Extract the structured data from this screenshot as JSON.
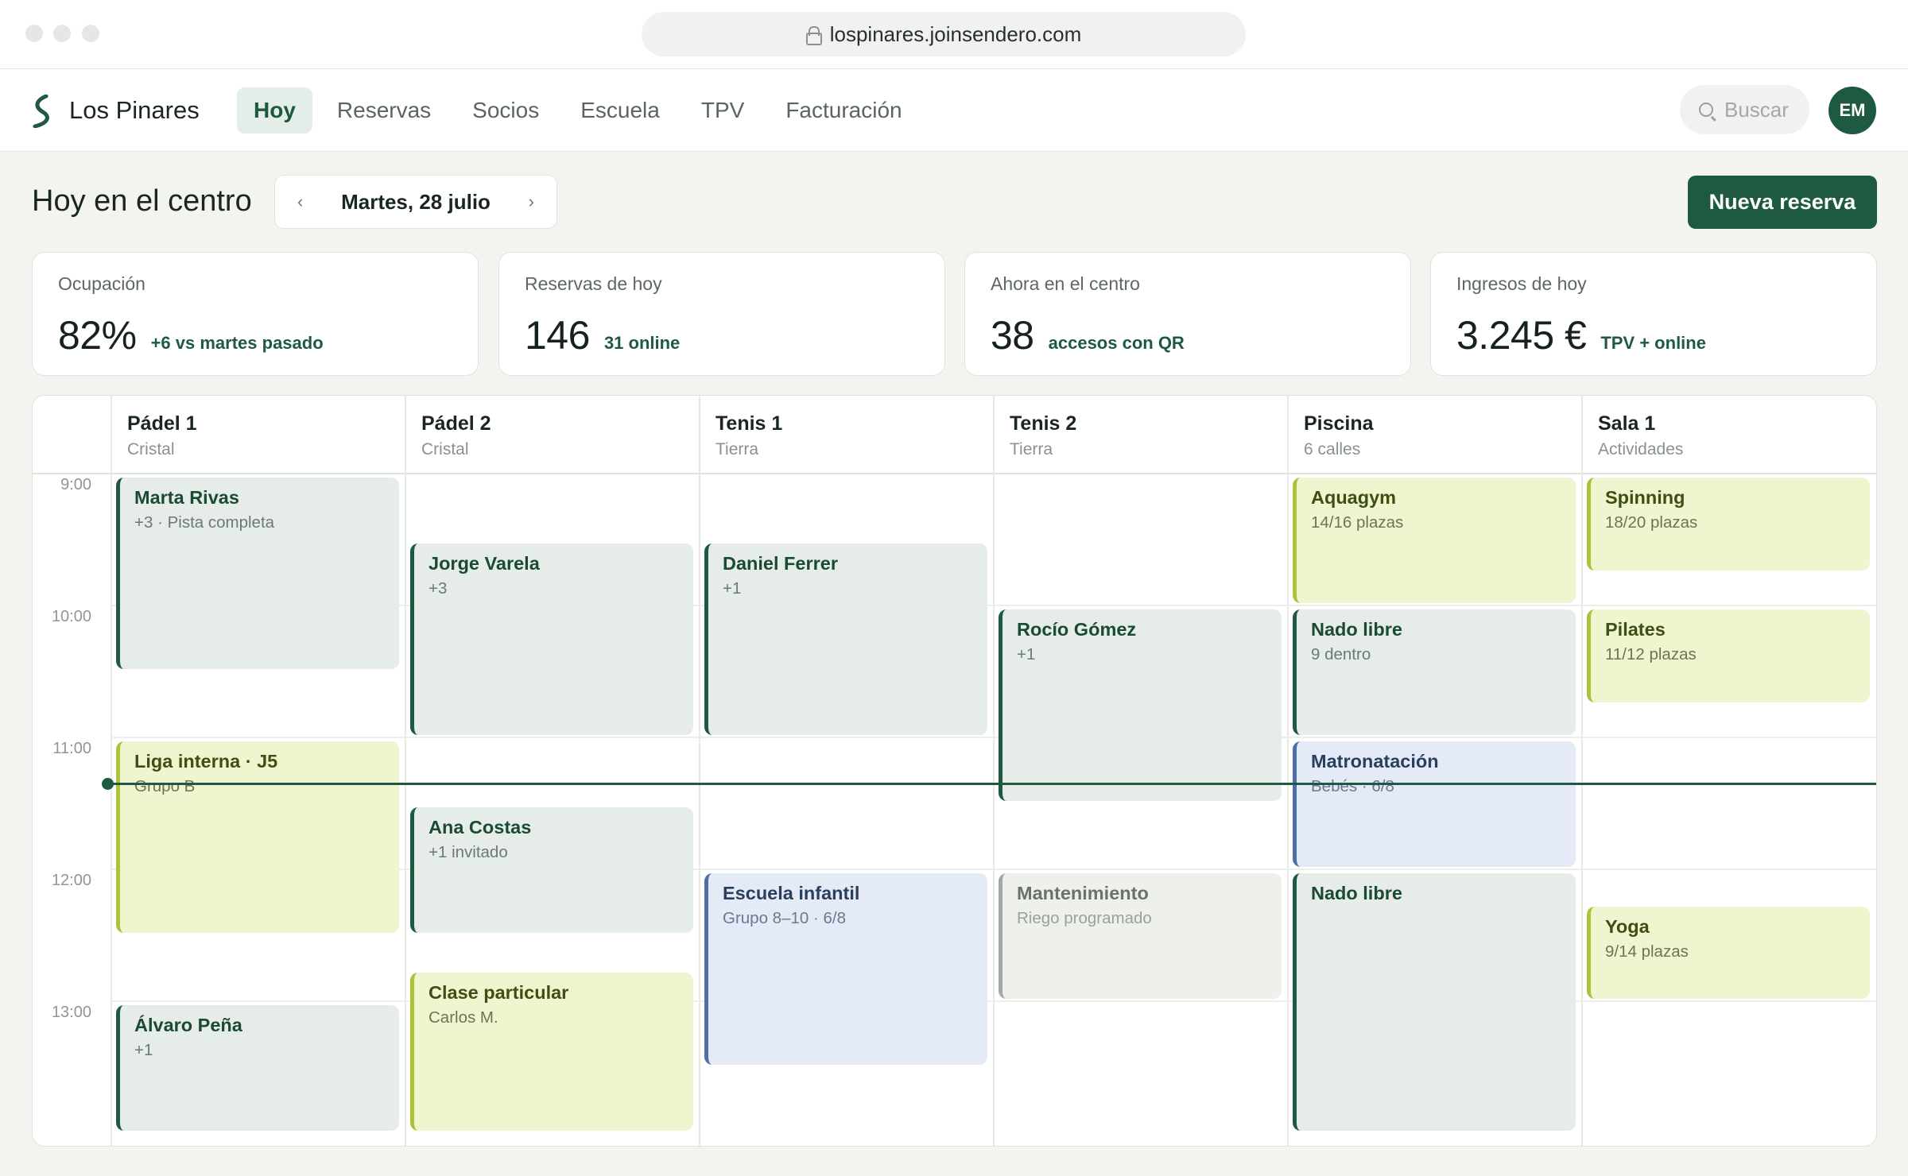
{
  "browser": {
    "url": "lospinares.joinsendero.com"
  },
  "app": {
    "brand": "Los Pinares",
    "nav": [
      "Hoy",
      "Reservas",
      "Socios",
      "Escuela",
      "TPV",
      "Facturación"
    ],
    "active_nav": "Hoy",
    "search_placeholder": "Buscar",
    "avatar_initials": "EM"
  },
  "header": {
    "title": "Hoy en el centro",
    "date": "Martes, 28 julio",
    "prev": "‹",
    "next": "›",
    "new_button": "Nueva reserva"
  },
  "stats": [
    {
      "label": "Ocupación",
      "value": "82%",
      "note": "+6 vs martes pasado"
    },
    {
      "label": "Reservas de hoy",
      "value": "146",
      "note": "31 online"
    },
    {
      "label": "Ahora en el centro",
      "value": "38",
      "note": "accesos con QR"
    },
    {
      "label": "Ingresos de hoy",
      "value": "3.245 €",
      "note": "TPV + online"
    }
  ],
  "calendar": {
    "times": [
      "9:00",
      "10:00",
      "11:00",
      "12:00",
      "13:00"
    ],
    "columns": [
      {
        "name": "Pádel 1",
        "sub": "Cristal"
      },
      {
        "name": "Pádel 2",
        "sub": "Cristal"
      },
      {
        "name": "Tenis 1",
        "sub": "Tierra"
      },
      {
        "name": "Tenis 2",
        "sub": "Tierra"
      },
      {
        "name": "Piscina",
        "sub": "6 calles"
      },
      {
        "name": "Sala 1",
        "sub": "Actividades"
      }
    ],
    "events": [
      {
        "col": 0,
        "start": "9:00",
        "end": "10:30",
        "kind": "booking",
        "title": "Marta Rivas",
        "sub": "+3 · Pista completa"
      },
      {
        "col": 0,
        "start": "11:00",
        "end": "12:30",
        "kind": "class",
        "title": "Liga interna · J5",
        "sub": "Grupo B"
      },
      {
        "col": 0,
        "start": "13:00",
        "end": "14:00",
        "kind": "booking",
        "title": "Álvaro Peña",
        "sub": "+1"
      },
      {
        "col": 1,
        "start": "9:30",
        "end": "11:00",
        "kind": "booking",
        "title": "Jorge Varela",
        "sub": "+3"
      },
      {
        "col": 1,
        "start": "11:30",
        "end": "12:30",
        "kind": "booking",
        "title": "Ana Costas",
        "sub": "+1 invitado"
      },
      {
        "col": 1,
        "start": "12:45",
        "end": "14:00",
        "kind": "class",
        "title": "Clase particular",
        "sub": "Carlos M."
      },
      {
        "col": 2,
        "start": "9:30",
        "end": "11:00",
        "kind": "booking",
        "title": "Daniel Ferrer",
        "sub": "+1"
      },
      {
        "col": 2,
        "start": "12:00",
        "end": "13:30",
        "kind": "school",
        "title": "Escuela infantil",
        "sub": "Grupo 8–10 · 6/8"
      },
      {
        "col": 3,
        "start": "10:00",
        "end": "11:30",
        "kind": "booking",
        "title": "Rocío Gómez",
        "sub": "+1"
      },
      {
        "col": 3,
        "start": "12:00",
        "end": "13:00",
        "kind": "maintenance",
        "title": "Mantenimiento",
        "sub": "Riego programado"
      },
      {
        "col": 4,
        "start": "9:00",
        "end": "10:00",
        "kind": "class",
        "title": "Aquagym",
        "sub": "14/16 plazas"
      },
      {
        "col": 4,
        "start": "10:00",
        "end": "11:00",
        "kind": "booking",
        "title": "Nado libre",
        "sub": "9 dentro"
      },
      {
        "col": 4,
        "start": "11:00",
        "end": "12:00",
        "kind": "school",
        "title": "Matronatación",
        "sub": "Bebés · 6/8"
      },
      {
        "col": 4,
        "start": "12:00",
        "end": "14:00",
        "kind": "booking",
        "title": "Nado libre",
        "sub": ""
      },
      {
        "col": 5,
        "start": "9:00",
        "end": "9:45",
        "kind": "class",
        "title": "Spinning",
        "sub": "18/20 plazas"
      },
      {
        "col": 5,
        "start": "10:00",
        "end": "10:45",
        "kind": "class",
        "title": "Pilates",
        "sub": "11/12 plazas"
      },
      {
        "col": 5,
        "start": "12:15",
        "end": "13:00",
        "kind": "class",
        "title": "Yoga",
        "sub": "9/14 plazas"
      }
    ],
    "now": "11:20"
  }
}
